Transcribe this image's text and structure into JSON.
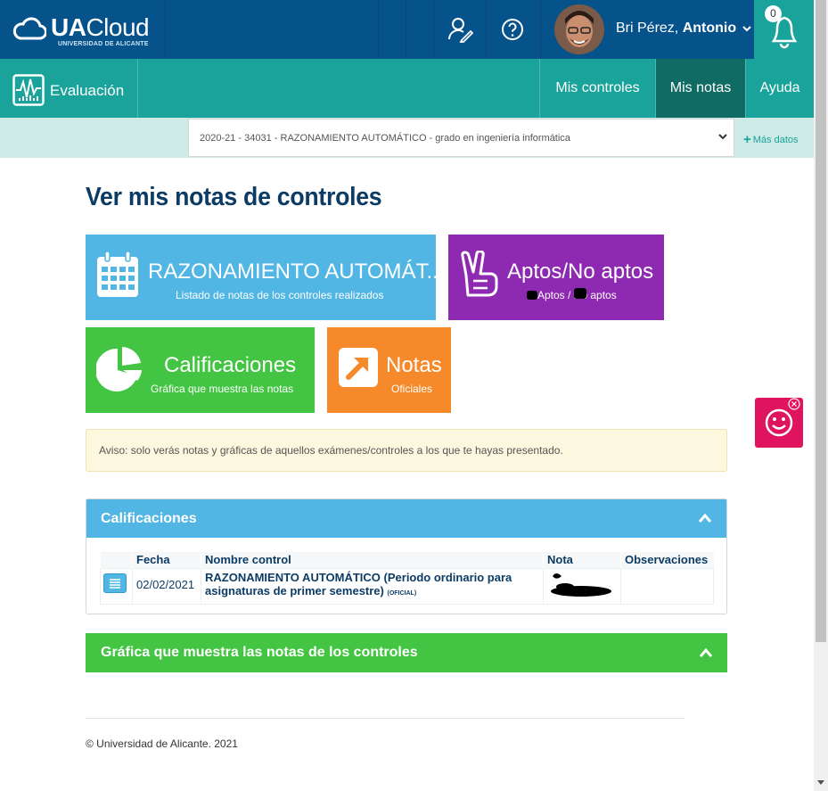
{
  "topbar": {
    "brand_ua": "UA",
    "brand_cloud": "Cloud",
    "brand_sub": "UNIVERSIDAD DE ALICANTE",
    "user_first": "Bri Pérez,",
    "user_last": "Antonio",
    "notifications_count": "0"
  },
  "app": {
    "name": "Evaluación"
  },
  "nav": {
    "items": [
      {
        "label": "Mis controles",
        "active": false
      },
      {
        "label": "Mis notas",
        "active": true
      },
      {
        "label": "Ayuda",
        "active": false
      }
    ]
  },
  "subject": {
    "selected": "2020-21 - 34031 - RAZONAMIENTO AUTOMÁTICO - grado en ingeniería informática",
    "more_label": "Más datos"
  },
  "page": {
    "title": "Ver mis notas de controles"
  },
  "tiles": [
    {
      "title": "RAZONAMIENTO AUTOMÁT...",
      "subtitle": "Listado de notas de los controles realizados",
      "color": "#52b6e5",
      "icon": "calendar-icon"
    },
    {
      "title": "Aptos/No aptos",
      "subtitle": "Aptos / No aptos",
      "color": "#8e2ab2",
      "icon": "hand-peace-icon"
    },
    {
      "title": "Calificaciones",
      "subtitle": "Gráfica que muestra las notas",
      "color": "#43c543",
      "icon": "pie-chart-icon"
    },
    {
      "title": "Notas",
      "subtitle": "Oficiales",
      "color": "#f68a2b",
      "icon": "external-link-icon"
    }
  ],
  "alert": {
    "text": "Aviso: solo verás notas y gráficas de aquellos exámenes/controles a los que te hayas presentado."
  },
  "grades_panel": {
    "title": "Calificaciones",
    "columns": [
      "",
      "Fecha",
      "Nombre control",
      "Nota",
      "Observaciones"
    ],
    "rows": [
      {
        "fecha": "02/02/2021",
        "control": "RAZONAMIENTO AUTOMÁTICO (Periodo ordinario para asignaturas de primer semestre)",
        "tag": "(OFICIAL)",
        "nota": "",
        "observaciones": ""
      }
    ]
  },
  "chart_panel": {
    "title": "Gráfica que muestra las notas de los controles"
  },
  "footer": {
    "text": "© Universidad de Alicante. 2021"
  },
  "colors": {
    "topbar": "#06538c",
    "accent": "#1aa39a",
    "blue": "#52b6e5",
    "purple": "#8e2ab2",
    "green": "#43c543",
    "orange": "#f68a2b",
    "feedback": "#e0135f"
  }
}
